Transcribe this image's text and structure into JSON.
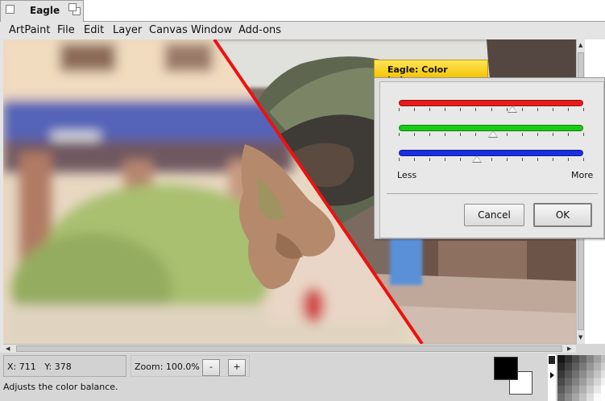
{
  "window": {
    "title": "Eagle"
  },
  "menu": [
    "ArtPaint",
    "File",
    "Edit",
    "Layer",
    "Canvas",
    "Window",
    "Add-ons"
  ],
  "dialog": {
    "title": "Eagle: Color balance",
    "sliders": [
      {
        "channel": "red",
        "color": "#e61c1c",
        "value": 0.615
      },
      {
        "channel": "green",
        "color": "#16cc16",
        "value": 0.51
      },
      {
        "channel": "blue",
        "color": "#1a2fe0",
        "value": 0.425
      }
    ],
    "less_label": "Less",
    "more_label": "More",
    "cancel_label": "Cancel",
    "ok_label": "OK"
  },
  "status": {
    "x_label": "X: 711",
    "y_label": "Y: 378",
    "zoom_label": "Zoom: 100.0%",
    "zoom_out": "-",
    "zoom_in": "+",
    "hint": "Adjusts the color balance."
  },
  "colors": {
    "foreground": "#000000",
    "background": "#ffffff",
    "accent": "#f5c400",
    "divider_line": "#ee1111"
  }
}
